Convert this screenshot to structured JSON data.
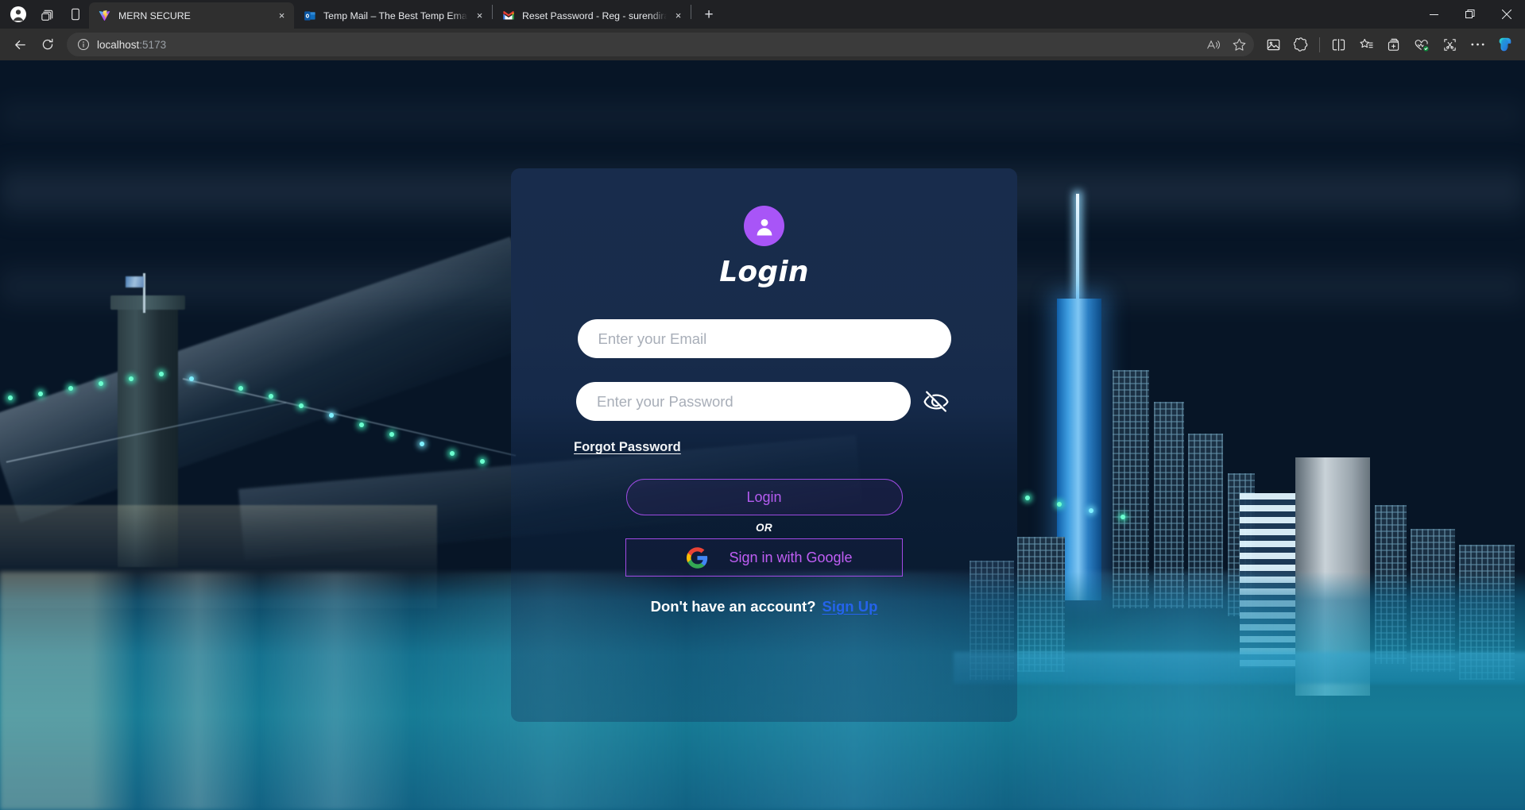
{
  "browser": {
    "profile_icon": "profile-avatar-icon",
    "collections_icon": "collections-icon",
    "split_pane_icon": "browser-essentials-icon",
    "tabs": [
      {
        "title": "MERN SECURE",
        "favicon": "vite-logo-icon",
        "active": true,
        "close_label": "×"
      },
      {
        "title": "Temp Mail – The Best Temp Email",
        "favicon": "outlook-mail-icon",
        "active": false,
        "close_label": "×"
      },
      {
        "title": "Reset Password - Reg - surendirasoft",
        "favicon": "gmail-icon",
        "active": false,
        "close_label": "×"
      }
    ],
    "new_tab_label": "+",
    "window_controls": {
      "minimize": "minimize-icon",
      "restore": "restore-icon",
      "close": "close-icon"
    },
    "toolbar": {
      "back": "back-arrow-icon",
      "refresh": "refresh-icon",
      "site_info": "site-info-icon",
      "url_host": "localhost",
      "url_port": ":5173",
      "url_full": "localhost:5173",
      "read_aloud": "read-aloud-icon",
      "favorite": "star-icon",
      "image_tool": "image-icon",
      "extensions": "extensions-icon",
      "split_screen": "split-screen-icon",
      "favorites_bar": "favorites-list-icon",
      "collections": "add-collection-icon",
      "browser_health": "browser-essentials-heart-icon",
      "screenshot": "web-capture-icon",
      "settings_more": "more-options-icon",
      "copilot": "copilot-icon"
    }
  },
  "page": {
    "card": {
      "avatar_icon": "user-avatar-icon",
      "title": "Login",
      "email_placeholder": "Enter your Email",
      "email_value": "",
      "password_placeholder": "Enter your Password",
      "password_value": "",
      "toggle_password_icon": "eye-off-icon",
      "forgot_password": "Forgot Password",
      "login_button": "Login",
      "divider": "OR",
      "google_button": "Sign in with Google",
      "google_icon": "google-g-icon",
      "signup_prompt": "Don't have an account?",
      "signup_link": "Sign Up"
    },
    "colors": {
      "accent_purple": "#a855f7",
      "button_purple": "#b45cf0",
      "link_blue": "#2563eb",
      "card_navy": "#182c4c",
      "input_white": "#ffffff"
    }
  }
}
